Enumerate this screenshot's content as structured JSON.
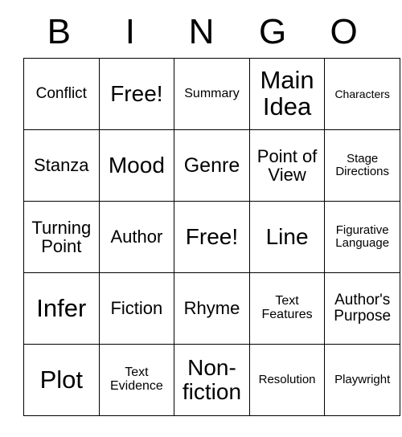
{
  "card": {
    "title_letters": [
      "B",
      "I",
      "N",
      "G",
      "O"
    ],
    "rows": [
      [
        {
          "label": "Conflict",
          "size": "s-lg"
        },
        {
          "label": "Free!",
          "size": "s-3xl"
        },
        {
          "label": "Summary",
          "size": "s-md"
        },
        {
          "label": "Main Idea",
          "size": "s-4xl"
        },
        {
          "label": "Characters",
          "size": "s-xs"
        }
      ],
      [
        {
          "label": "Stanza",
          "size": "s-xl"
        },
        {
          "label": "Mood",
          "size": "s-3xl"
        },
        {
          "label": "Genre",
          "size": "s-2xl"
        },
        {
          "label": "Point of View",
          "size": "s-xl"
        },
        {
          "label": "Stage Directions",
          "size": "s-sm"
        }
      ],
      [
        {
          "label": "Turning Point",
          "size": "s-xl"
        },
        {
          "label": "Author",
          "size": "s-xl"
        },
        {
          "label": "Free!",
          "size": "s-3xl"
        },
        {
          "label": "Line",
          "size": "s-3xl"
        },
        {
          "label": "Figurative Language",
          "size": "s-sm"
        }
      ],
      [
        {
          "label": "Infer",
          "size": "s-4xl"
        },
        {
          "label": "Fiction",
          "size": "s-xl"
        },
        {
          "label": "Rhyme",
          "size": "s-xl"
        },
        {
          "label": "Text Features",
          "size": "s-md"
        },
        {
          "label": "Author's Purpose",
          "size": "s-lg"
        }
      ],
      [
        {
          "label": "Plot",
          "size": "s-4xl"
        },
        {
          "label": "Text Evidence",
          "size": "s-md"
        },
        {
          "label": "Non-fiction",
          "size": "s-3xl"
        },
        {
          "label": "Resolution",
          "size": "s-sm"
        },
        {
          "label": "Playwright",
          "size": "s-sm"
        }
      ]
    ]
  },
  "colors": {
    "background": "#ffffff",
    "border": "#000000",
    "text": "#000000"
  }
}
